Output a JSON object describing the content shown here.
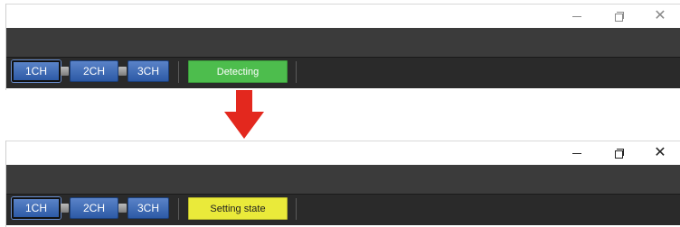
{
  "panels": [
    {
      "channels": [
        "1CH",
        "2CH",
        "3CH"
      ],
      "active_channel": "1CH",
      "status": "Detecting",
      "status_color": "#4dbd4d"
    },
    {
      "channels": [
        "1CH",
        "2CH",
        "3CH"
      ],
      "active_channel": "1CH",
      "status": "Setting state",
      "status_color": "#eaea3a"
    }
  ],
  "window_controls": {
    "minimize_icon": "minimize-icon",
    "maximize_icon": "restore-icon",
    "close_icon": "close-icon",
    "close_glyph": "✕"
  },
  "transition": {
    "icon": "arrow-down-icon",
    "color": "#e3281e"
  }
}
